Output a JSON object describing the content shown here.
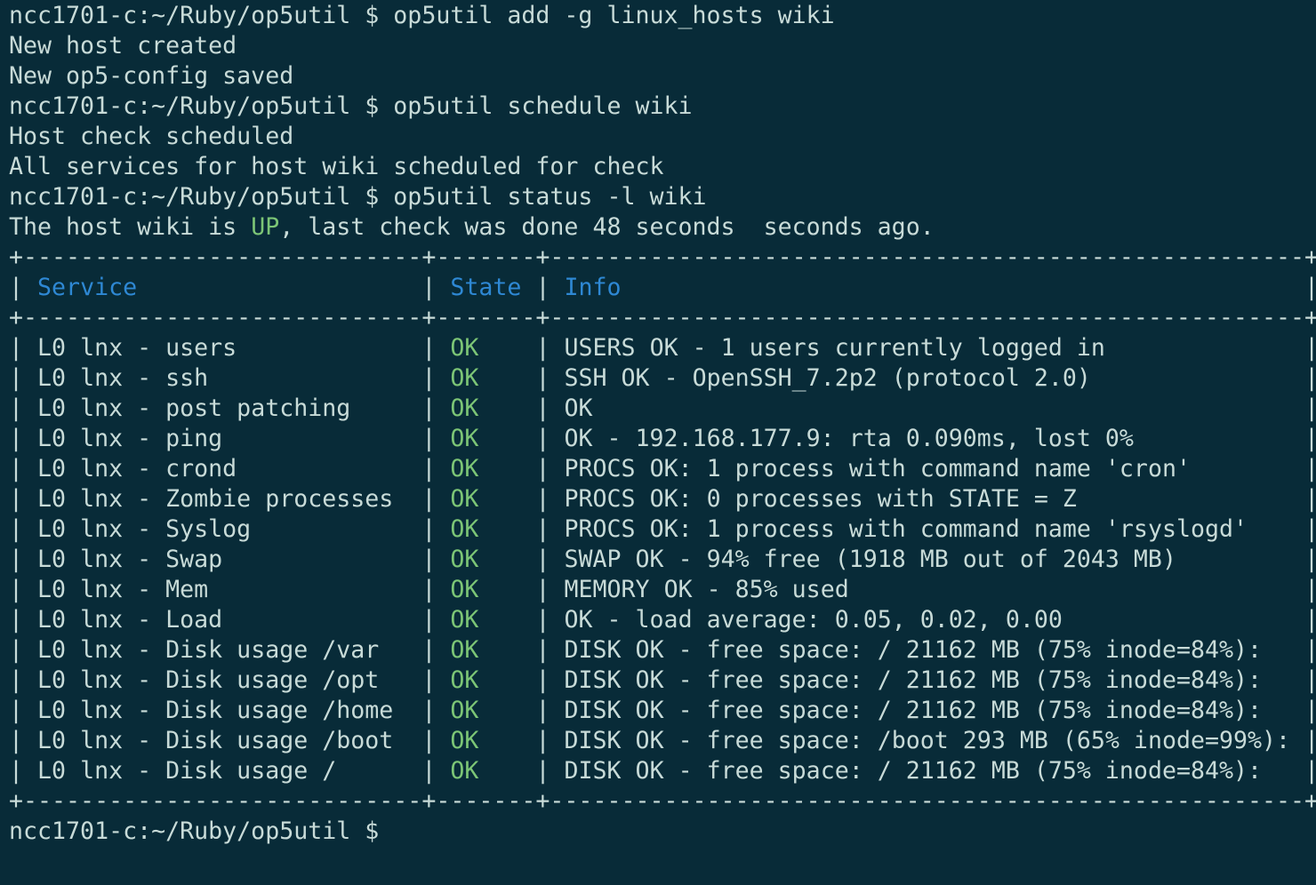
{
  "colors": {
    "background": "#082b38",
    "text": "#c8dbd8",
    "ok": "#7cc576",
    "header": "#2e88d4"
  },
  "prompt": "ncc1701-c:~/Ruby/op5util $",
  "session": [
    {
      "type": "cmd",
      "text": "op5util add -g linux_hosts wiki"
    },
    {
      "type": "out",
      "text": "New host created"
    },
    {
      "type": "out",
      "text": "New op5-config saved"
    },
    {
      "type": "cmd",
      "text": "op5util schedule wiki"
    },
    {
      "type": "out",
      "text": "Host check scheduled"
    },
    {
      "type": "out",
      "text": "All services for host wiki scheduled for check"
    },
    {
      "type": "cmd",
      "text": "op5util status -l wiki"
    }
  ],
  "status_line": {
    "before": "The host wiki is ",
    "state": "UP",
    "after": ", last check was done 48 seconds  seconds ago."
  },
  "table": {
    "headers": [
      "Service",
      "State",
      "Info"
    ],
    "rows": [
      [
        "L0 lnx - users",
        "OK",
        "USERS OK - 1 users currently logged in"
      ],
      [
        "L0 lnx - ssh",
        "OK",
        "SSH OK - OpenSSH_7.2p2 (protocol 2.0)"
      ],
      [
        "L0 lnx - post patching",
        "OK",
        "OK"
      ],
      [
        "L0 lnx - ping",
        "OK",
        "OK - 192.168.177.9: rta 0.090ms, lost 0%"
      ],
      [
        "L0 lnx - crond",
        "OK",
        "PROCS OK: 1 process with command name 'cron'"
      ],
      [
        "L0 lnx - Zombie processes",
        "OK",
        "PROCS OK: 0 processes with STATE = Z"
      ],
      [
        "L0 lnx - Syslog",
        "OK",
        "PROCS OK: 1 process with command name 'rsyslogd'"
      ],
      [
        "L0 lnx - Swap",
        "OK",
        "SWAP OK - 94% free (1918 MB out of 2043 MB)"
      ],
      [
        "L0 lnx - Mem",
        "OK",
        "MEMORY OK - 85% used"
      ],
      [
        "L0 lnx - Load",
        "OK",
        "OK - load average: 0.05, 0.02, 0.00"
      ],
      [
        "L0 lnx - Disk usage /var",
        "OK",
        "DISK OK - free space: / 21162 MB (75% inode=84%):"
      ],
      [
        "L0 lnx - Disk usage /opt",
        "OK",
        "DISK OK - free space: / 21162 MB (75% inode=84%):"
      ],
      [
        "L0 lnx - Disk usage /home",
        "OK",
        "DISK OK - free space: / 21162 MB (75% inode=84%):"
      ],
      [
        "L0 lnx - Disk usage /boot",
        "OK",
        "DISK OK - free space: /boot 293 MB (65% inode=99%):"
      ],
      [
        "L0 lnx - Disk usage /",
        "OK",
        "DISK OK - free space: / 21162 MB (75% inode=84%):"
      ]
    ]
  }
}
